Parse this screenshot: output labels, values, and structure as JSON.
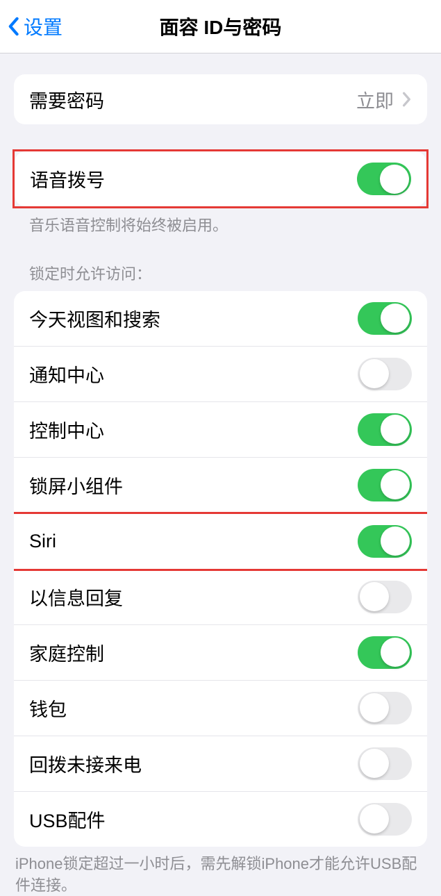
{
  "header": {
    "back_label": "设置",
    "title": "面容 ID与密码"
  },
  "require_passcode": {
    "label": "需要密码",
    "value": "立即"
  },
  "voice_dial": {
    "label": "语音拨号",
    "on": true,
    "footer": "音乐语音控制将始终被启用。"
  },
  "lock_access": {
    "header": "锁定时允许访问：",
    "items": [
      {
        "label": "今天视图和搜索",
        "on": true
      },
      {
        "label": "通知中心",
        "on": false
      },
      {
        "label": "控制中心",
        "on": true
      },
      {
        "label": "锁屏小组件",
        "on": true
      },
      {
        "label": "Siri",
        "on": true
      },
      {
        "label": "以信息回复",
        "on": false
      },
      {
        "label": "家庭控制",
        "on": true
      },
      {
        "label": "钱包",
        "on": false
      },
      {
        "label": "回拨未接来电",
        "on": false
      },
      {
        "label": "USB配件",
        "on": false
      }
    ],
    "footer": "iPhone锁定超过一小时后，需先解锁iPhone才能允许USB配件连接。"
  },
  "highlights": {
    "voice_dial_group": true,
    "siri_row_index": 4
  }
}
